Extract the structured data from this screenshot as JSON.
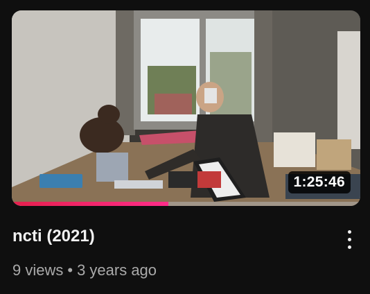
{
  "video": {
    "duration": "1:25:46",
    "title": "ncti (2021)",
    "views": "9 views",
    "separator": "•",
    "age": "3 years ago",
    "watch_progress_percent": 45
  },
  "colors": {
    "accent": "#ff0033",
    "progress_start": "#e5204d",
    "progress_end": "#ff2d8a"
  },
  "icons": {
    "more": "more-vert-icon"
  }
}
